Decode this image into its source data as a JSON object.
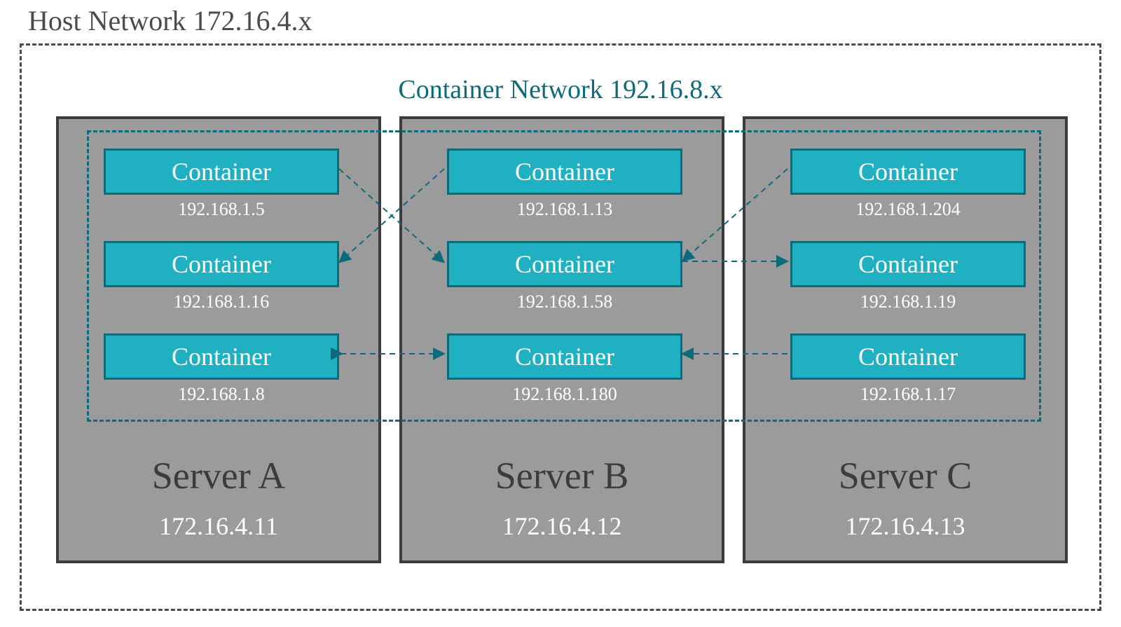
{
  "host_network": {
    "title": "Host Network 172.16.4.x"
  },
  "container_network": {
    "title": "Container Network 192.16.8.x"
  },
  "servers": [
    {
      "name": "Server A",
      "ip": "172.16.4.11",
      "containers": [
        {
          "label": "Container",
          "ip": "192.168.1.5"
        },
        {
          "label": "Container",
          "ip": "192.168.1.16"
        },
        {
          "label": "Container",
          "ip": "192.168.1.8"
        }
      ]
    },
    {
      "name": "Server B",
      "ip": "172.16.4.12",
      "containers": [
        {
          "label": "Container",
          "ip": "192.168.1.13"
        },
        {
          "label": "Container",
          "ip": "192.168.1.58"
        },
        {
          "label": "Container",
          "ip": "192.168.1.180"
        }
      ]
    },
    {
      "name": "Server C",
      "ip": "172.16.4.13",
      "containers": [
        {
          "label": "Container",
          "ip": "192.168.1.204"
        },
        {
          "label": "Container",
          "ip": "192.168.1.19"
        },
        {
          "label": "Container",
          "ip": "192.168.1.17"
        }
      ]
    }
  ],
  "connections": [
    {
      "from": "A.0",
      "to": "B.1",
      "bidir": false
    },
    {
      "from": "B.0",
      "to": "A.1",
      "bidir": false
    },
    {
      "from": "A.2",
      "to": "B.2",
      "bidir": true
    },
    {
      "from": "B.1",
      "to": "C.1",
      "bidir": false
    },
    {
      "from": "C.0",
      "to": "B.1",
      "bidir": false
    },
    {
      "from": "C.2",
      "to": "B.2",
      "bidir": false
    }
  ]
}
